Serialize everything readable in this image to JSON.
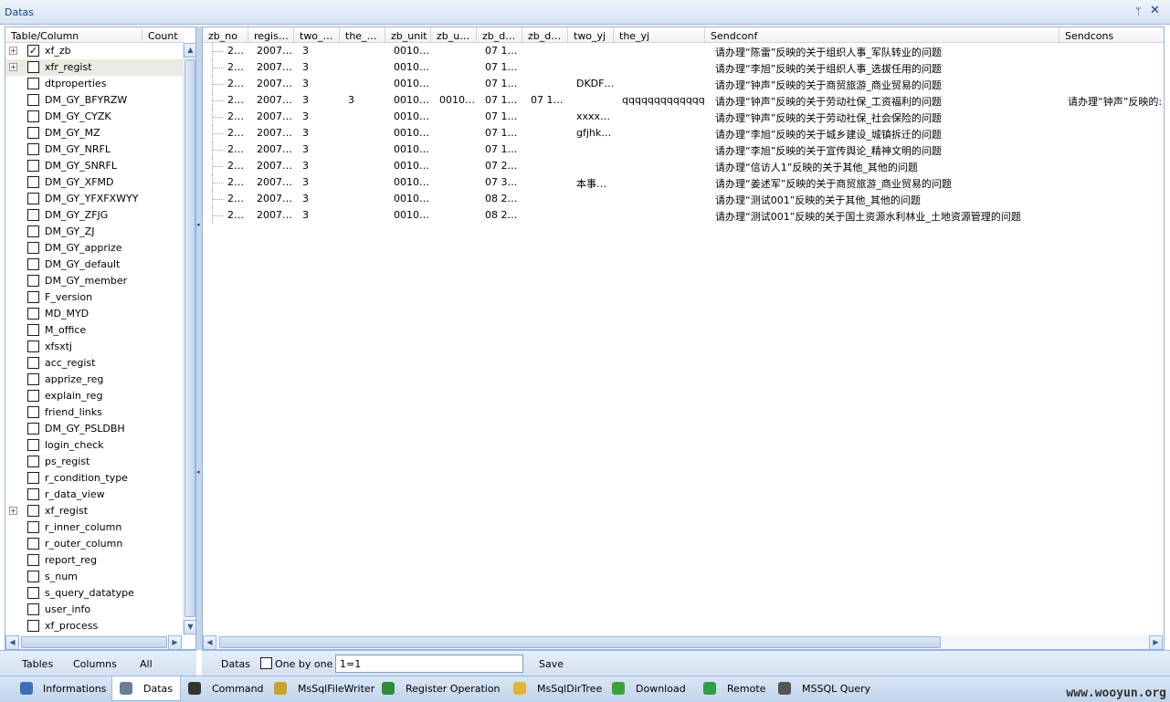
{
  "window": {
    "title": "Datas",
    "pin_glyph": "ᛘ",
    "close_glyph": "✕"
  },
  "left_panel": {
    "col_table": "Table/Column",
    "col_count": "Count",
    "items": [
      {
        "label": "xf_zb",
        "checked": true,
        "expandable": true
      },
      {
        "label": "xfr_regist",
        "checked": false,
        "expandable": true,
        "selected": true
      },
      {
        "label": "dtproperties",
        "checked": false
      },
      {
        "label": "DM_GY_BFYRZW",
        "checked": false
      },
      {
        "label": "DM_GY_CYZK",
        "checked": false
      },
      {
        "label": "DM_GY_MZ",
        "checked": false
      },
      {
        "label": "DM_GY_NRFL",
        "checked": false
      },
      {
        "label": "DM_GY_SNRFL",
        "checked": false
      },
      {
        "label": "DM_GY_XFMD",
        "checked": false
      },
      {
        "label": "DM_GY_YFXFXWYY",
        "checked": false
      },
      {
        "label": "DM_GY_ZFJG",
        "checked": false
      },
      {
        "label": "DM_GY_ZJ",
        "checked": false
      },
      {
        "label": "DM_GY_apprize",
        "checked": false
      },
      {
        "label": "DM_GY_default",
        "checked": false
      },
      {
        "label": "DM_GY_member",
        "checked": false
      },
      {
        "label": "F_version",
        "checked": false
      },
      {
        "label": "MD_MYD",
        "checked": false
      },
      {
        "label": "M_office",
        "checked": false
      },
      {
        "label": "xfsxtj",
        "checked": false
      },
      {
        "label": "acc_regist",
        "checked": false
      },
      {
        "label": "apprize_reg",
        "checked": false
      },
      {
        "label": "explain_reg",
        "checked": false
      },
      {
        "label": "friend_links",
        "checked": false
      },
      {
        "label": "DM_GY_PSLDBH",
        "checked": false
      },
      {
        "label": "login_check",
        "checked": false
      },
      {
        "label": "ps_regist",
        "checked": false
      },
      {
        "label": "r_condition_type",
        "checked": false
      },
      {
        "label": "r_data_view",
        "checked": false
      },
      {
        "label": "xf_regist",
        "checked": false,
        "expandable": true
      },
      {
        "label": "r_inner_column",
        "checked": false
      },
      {
        "label": "r_outer_column",
        "checked": false
      },
      {
        "label": "report_reg",
        "checked": false
      },
      {
        "label": "s_num",
        "checked": false
      },
      {
        "label": "s_query_datatype",
        "checked": false
      },
      {
        "label": "user_info",
        "checked": false
      },
      {
        "label": "xf_process",
        "checked": false
      }
    ],
    "bottom": {
      "tables": "Tables",
      "columns": "Columns",
      "all": "All"
    }
  },
  "grid": {
    "columns": [
      "zb_no",
      "regis…",
      "two_…",
      "the_…",
      "zb_unit",
      "zb_u…",
      "zb_d…",
      "zb_d…",
      "two_yj",
      "the_yj",
      "Sendconf",
      "Sendcons"
    ],
    "rows": [
      [
        "2…",
        "2007…",
        "3",
        "",
        "0010…",
        "",
        "07 1…",
        "",
        "",
        "",
        "请办理“陈雷”反映的关于组织人事_军队转业的问题",
        ""
      ],
      [
        "2…",
        "2007…",
        "3",
        "",
        "0010…",
        "",
        "07 1…",
        "",
        "",
        "",
        "请办理“李旭”反映的关于组织人事_选拔任用的问题",
        ""
      ],
      [
        "2…",
        "2007…",
        "3",
        "",
        "0010…",
        "",
        "07 1…",
        "",
        "DKDF…",
        "",
        "请办理“钟声”反映的关于商贸旅游_商业贸易的问题",
        ""
      ],
      [
        "2…",
        "2007…",
        "3",
        "3",
        "0010…",
        "0010…",
        "07 1…",
        "07 1…",
        "",
        "qqqqqqqqqqqqq…",
        "请办理“钟声”反映的关于劳动社保_工资福利的问题",
        "请办理“钟声”反映的:"
      ],
      [
        "2…",
        "2007…",
        "3",
        "",
        "0010…",
        "",
        "07 1…",
        "",
        "xxxx…",
        "",
        "请办理“钟声”反映的关于劳动社保_社会保险的问题",
        ""
      ],
      [
        "2…",
        "2007…",
        "3",
        "",
        "0010…",
        "",
        "07 1…",
        "",
        "gfjhk…",
        "",
        "请办理“李旭”反映的关于城乡建设_城镇拆迁的问题",
        ""
      ],
      [
        "2…",
        "2007…",
        "3",
        "",
        "0010…",
        "",
        "07 1…",
        "",
        "",
        "",
        "请办理“李旭”反映的关于宣传舆论_精神文明的问题",
        ""
      ],
      [
        "2…",
        "2007…",
        "3",
        "",
        "0010…",
        "",
        "07 2…",
        "",
        "",
        "",
        "请办理“信访人1”反映的关于其他_其他的问题",
        ""
      ],
      [
        "2…",
        "2007…",
        "3",
        "",
        "0010…",
        "",
        "07 3…",
        "",
        "本事…",
        "",
        "请办理“姜述军”反映的关于商贸旅游_商业贸易的问题",
        ""
      ],
      [
        "2…",
        "2007…",
        "3",
        "",
        "0010…",
        "",
        "08  2…",
        "",
        "",
        "",
        "请办理“测试001”反映的关于其他_其他的问题",
        ""
      ],
      [
        "2…",
        "2007…",
        "3",
        "",
        "0010…",
        "",
        "08  2…",
        "",
        "",
        "",
        "请办理“测试001”反映的关于国土资源水利林业_土地资源管理的问题",
        ""
      ]
    ]
  },
  "datas_bar": {
    "datas_label": "Datas",
    "one_by_one_label": "One by one",
    "filter_value": "1=1",
    "save_label": "Save"
  },
  "tabs": [
    {
      "label": "Informations",
      "icon": "info-icon",
      "color": "#3b6fb6"
    },
    {
      "label": "Datas",
      "icon": "database-icon",
      "color": "#6b7d95",
      "active": true
    },
    {
      "label": "Command",
      "icon": "terminal-icon",
      "color": "#333333"
    },
    {
      "label": "MsSqlFileWriter",
      "icon": "file-writer-icon",
      "color": "#c9a227"
    },
    {
      "label": "Register Operation",
      "icon": "register-icon",
      "color": "#2e8b3a"
    },
    {
      "label": "MsSqlDirTree",
      "icon": "folder-icon",
      "color": "#e0b533"
    },
    {
      "label": "Download",
      "icon": "download-icon",
      "color": "#3aa33a"
    },
    {
      "label": "Remote",
      "icon": "globe-icon",
      "color": "#2f9e44"
    },
    {
      "label": "MSSQL Query",
      "icon": "sql-icon",
      "color": "#555555"
    }
  ],
  "watermark": "www.wooyun.org"
}
